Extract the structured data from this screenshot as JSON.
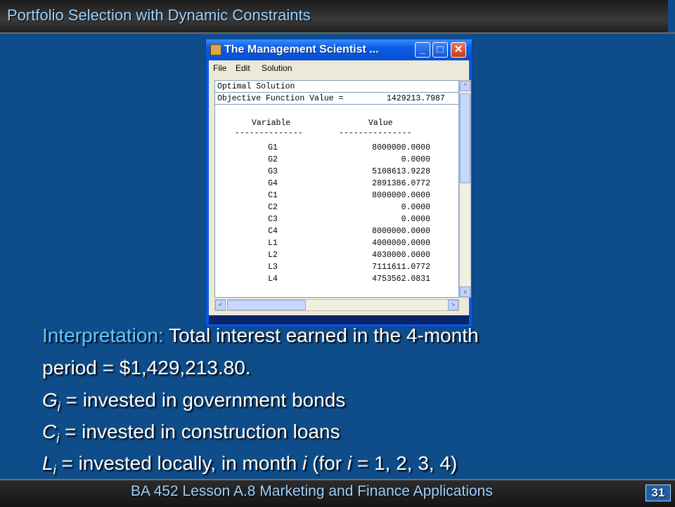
{
  "slide": {
    "title": "Portfolio Selection with Dynamic Constraints",
    "footer": "BA 452  Lesson A.8 Marketing and Finance Applications",
    "page_number": "31"
  },
  "window": {
    "title": "The Management Scientist ...",
    "buttons": {
      "minimize": "_",
      "maximize": "□",
      "close": "✕"
    },
    "menu": [
      "File",
      "Edit",
      "Solution"
    ],
    "output": {
      "heading": "Optimal Solution",
      "objective_label": "Objective Function Value =",
      "objective_value": "1429213.7987",
      "col_variable": "Variable",
      "col_value": "Value",
      "col_rule_variable": "--------------",
      "col_rule_value": "---------------",
      "rows": [
        {
          "var": "G1",
          "value": "8000000.0000"
        },
        {
          "var": "G2",
          "value": "0.0000"
        },
        {
          "var": "G3",
          "value": "5108613.9228"
        },
        {
          "var": "G4",
          "value": "2891386.0772"
        },
        {
          "var": "C1",
          "value": "8000000.0000"
        },
        {
          "var": "C2",
          "value": "0.0000"
        },
        {
          "var": "C3",
          "value": "0.0000"
        },
        {
          "var": "C4",
          "value": "8000000.0000"
        },
        {
          "var": "L1",
          "value": "4000000.0000"
        },
        {
          "var": "L2",
          "value": "4030000.0000"
        },
        {
          "var": "L3",
          "value": "7111611.0772"
        },
        {
          "var": "L4",
          "value": "4753562.0831"
        }
      ]
    },
    "scroll_icons": {
      "up": "^",
      "down": "v",
      "left": "<",
      "right": ">"
    }
  },
  "interpretation": {
    "label": "Interpretation:",
    "line1": "Total interest earned in the 4-month",
    "line2": "period = $1,429,213.80.",
    "g_letter": "G",
    "g_sub": "i",
    "g_text": " =  invested in government bonds",
    "c_letter": "C",
    "c_sub": "i",
    "c_text": " =  invested in construction loans",
    "l_letter": "L",
    "l_sub": "i",
    "l_text_a": " =   invested locally, in month ",
    "l_i": "i",
    "l_text_b": " (for ",
    "l_i2": "i",
    "l_text_c": " = 1, 2, 3, 4)"
  }
}
